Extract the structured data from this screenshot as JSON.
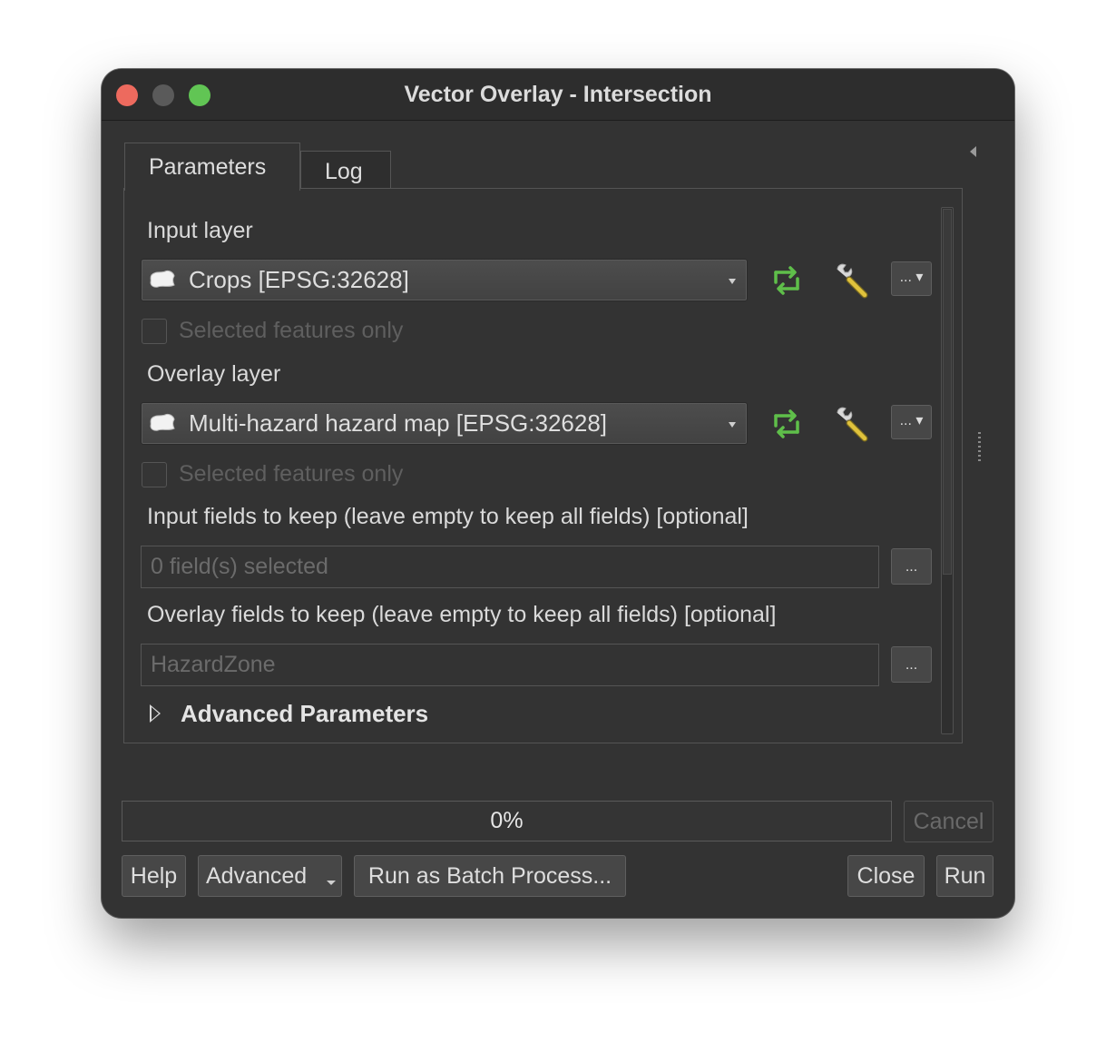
{
  "window": {
    "title": "Vector Overlay - Intersection"
  },
  "tabs": {
    "parameters": "Parameters",
    "log": "Log"
  },
  "input_layer": {
    "label": "Input layer",
    "value": "Crops [EPSG:32628]",
    "selected_only_label": "Selected features only",
    "selected_only_checked": false,
    "menu_button": "...",
    "icons": {
      "layer": "polygon-layer-icon",
      "iterate": "iterate-icon",
      "settings": "wrench-icon"
    }
  },
  "overlay_layer": {
    "label": "Overlay layer",
    "value": "Multi-hazard hazard map [EPSG:32628]",
    "selected_only_label": "Selected features only",
    "selected_only_checked": false,
    "menu_button": "...",
    "icons": {
      "layer": "polygon-layer-icon",
      "iterate": "iterate-icon",
      "settings": "wrench-icon"
    }
  },
  "input_fields": {
    "label": "Input fields to keep (leave empty to keep all fields) [optional]",
    "value": "0 field(s) selected",
    "button": "..."
  },
  "overlay_fields": {
    "label": "Overlay fields to keep (leave empty to keep all fields) [optional]",
    "value": "HazardZone",
    "button": "..."
  },
  "advanced_parameters": {
    "label": "Advanced Parameters",
    "expanded": false
  },
  "progress": {
    "text": "0%",
    "value": 0
  },
  "buttons": {
    "cancel": "Cancel",
    "help": "Help",
    "advanced": "Advanced",
    "batch": "Run as Batch Process...",
    "close": "Close",
    "run": "Run"
  },
  "colors": {
    "iterate_icon": "#5fbf4a",
    "wrench_handle": "#e0c23c",
    "close_dot": "#ed6a5e",
    "zoom_dot": "#61c554"
  }
}
